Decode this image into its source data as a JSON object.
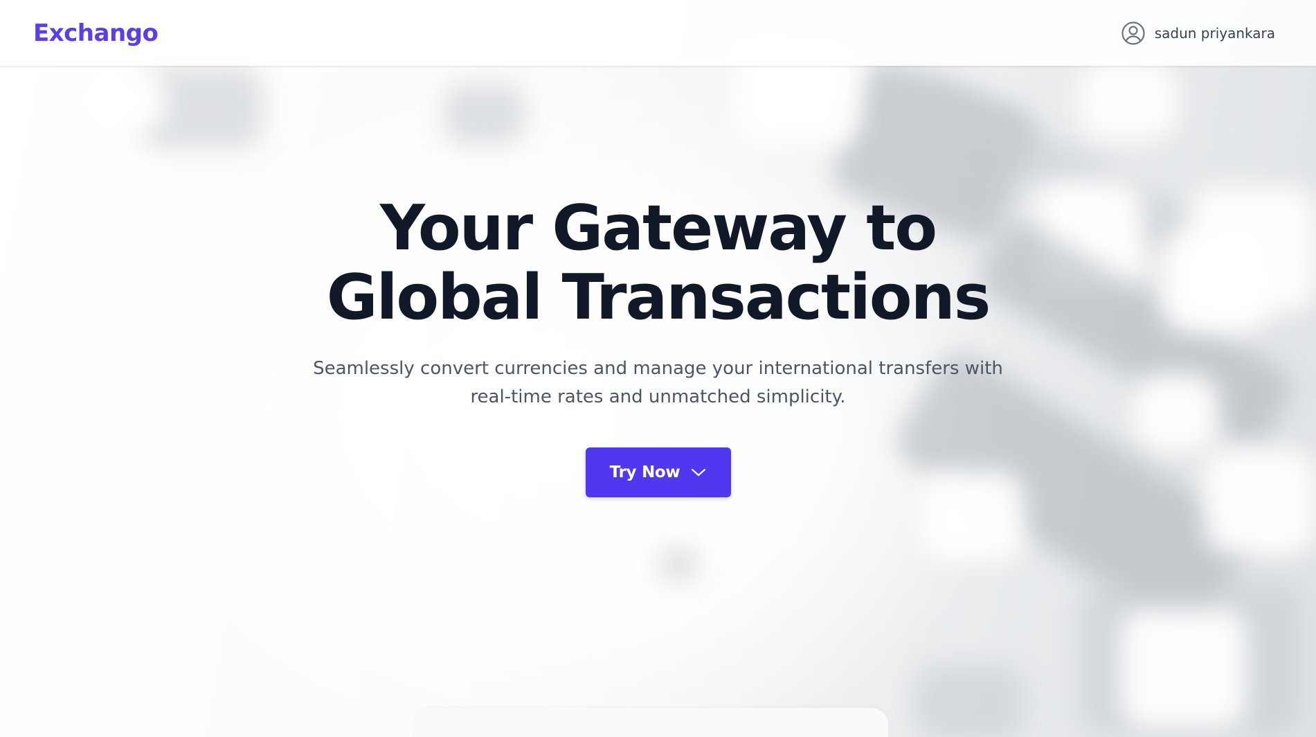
{
  "header": {
    "logo": "Exchango",
    "user": {
      "icon": "user-circle-icon",
      "name": "sadun priyankara"
    }
  },
  "hero": {
    "title_line1": "Your Gateway to",
    "title_line2": "Global Transactions",
    "subtitle_line1": "Seamlessly convert currencies and manage your international transfers with",
    "subtitle_line2": "real-time rates and unmatched simplicity.",
    "cta": {
      "label": "Try Now",
      "icon": "chevron-down-icon"
    }
  },
  "colors": {
    "brand": "#5a3ee8",
    "button": "#4f38f0",
    "title": "#111827",
    "subtitle": "#4b5563"
  }
}
